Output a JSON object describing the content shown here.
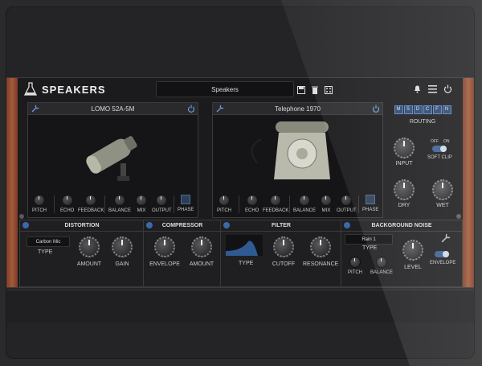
{
  "app": {
    "name": "SPEAKERS"
  },
  "preset": {
    "value": "Speakers"
  },
  "icons": {
    "logo": "flask-icon",
    "up_down": "up-down-arrows-icon",
    "save": "save-icon",
    "delete": "trash-icon",
    "random": "dice-icon",
    "bell": "bell-icon",
    "menu": "hamburger-menu-icon",
    "power": "power-icon"
  },
  "left_panel": {
    "title": "LOMO 52A-5M",
    "knobs": [
      "PITCH",
      "ECHO",
      "FEEDBACK",
      "BALANCE",
      "MIX",
      "OUTPUT",
      "PHASE"
    ]
  },
  "right_panel": {
    "title": "Telephone 1970",
    "knobs": [
      "PITCH",
      "ECHO",
      "FEEDBACK",
      "BALANCE",
      "MIX",
      "OUTPUT",
      "PHASE"
    ]
  },
  "routing": {
    "buttons": [
      "M",
      "S",
      "D",
      "C",
      "F",
      "N"
    ],
    "label": "ROUTING",
    "off": "OFF",
    "on": "ON",
    "soft_clip": "SOFT CLIP",
    "input": "INPUT",
    "dry": "DRY",
    "wet": "WET"
  },
  "distortion": {
    "title": "DISTORTION",
    "type_value": "Carbon Mic",
    "type_label": "TYPE",
    "amount": "AMOUNT",
    "gain": "GAIN"
  },
  "compressor": {
    "title": "COMPRESSOR",
    "envelope": "ENVELOPE",
    "amount": "AMOUNT"
  },
  "filter": {
    "title": "FILTER",
    "type": "TYPE",
    "cutoff": "CUTOFF",
    "resonance": "RESONANCE"
  },
  "noise": {
    "title": "BACKGROUND NOISE",
    "type_value": "Rain 1",
    "type_label": "TYPE",
    "pitch": "PITCH",
    "balance": "BALANCE",
    "level": "LEVEL",
    "envelope": "ENVELOPE"
  },
  "colors": {
    "accent": "#3b6ab0",
    "wood": "#9a5236",
    "bg": "#1b1b1d"
  }
}
